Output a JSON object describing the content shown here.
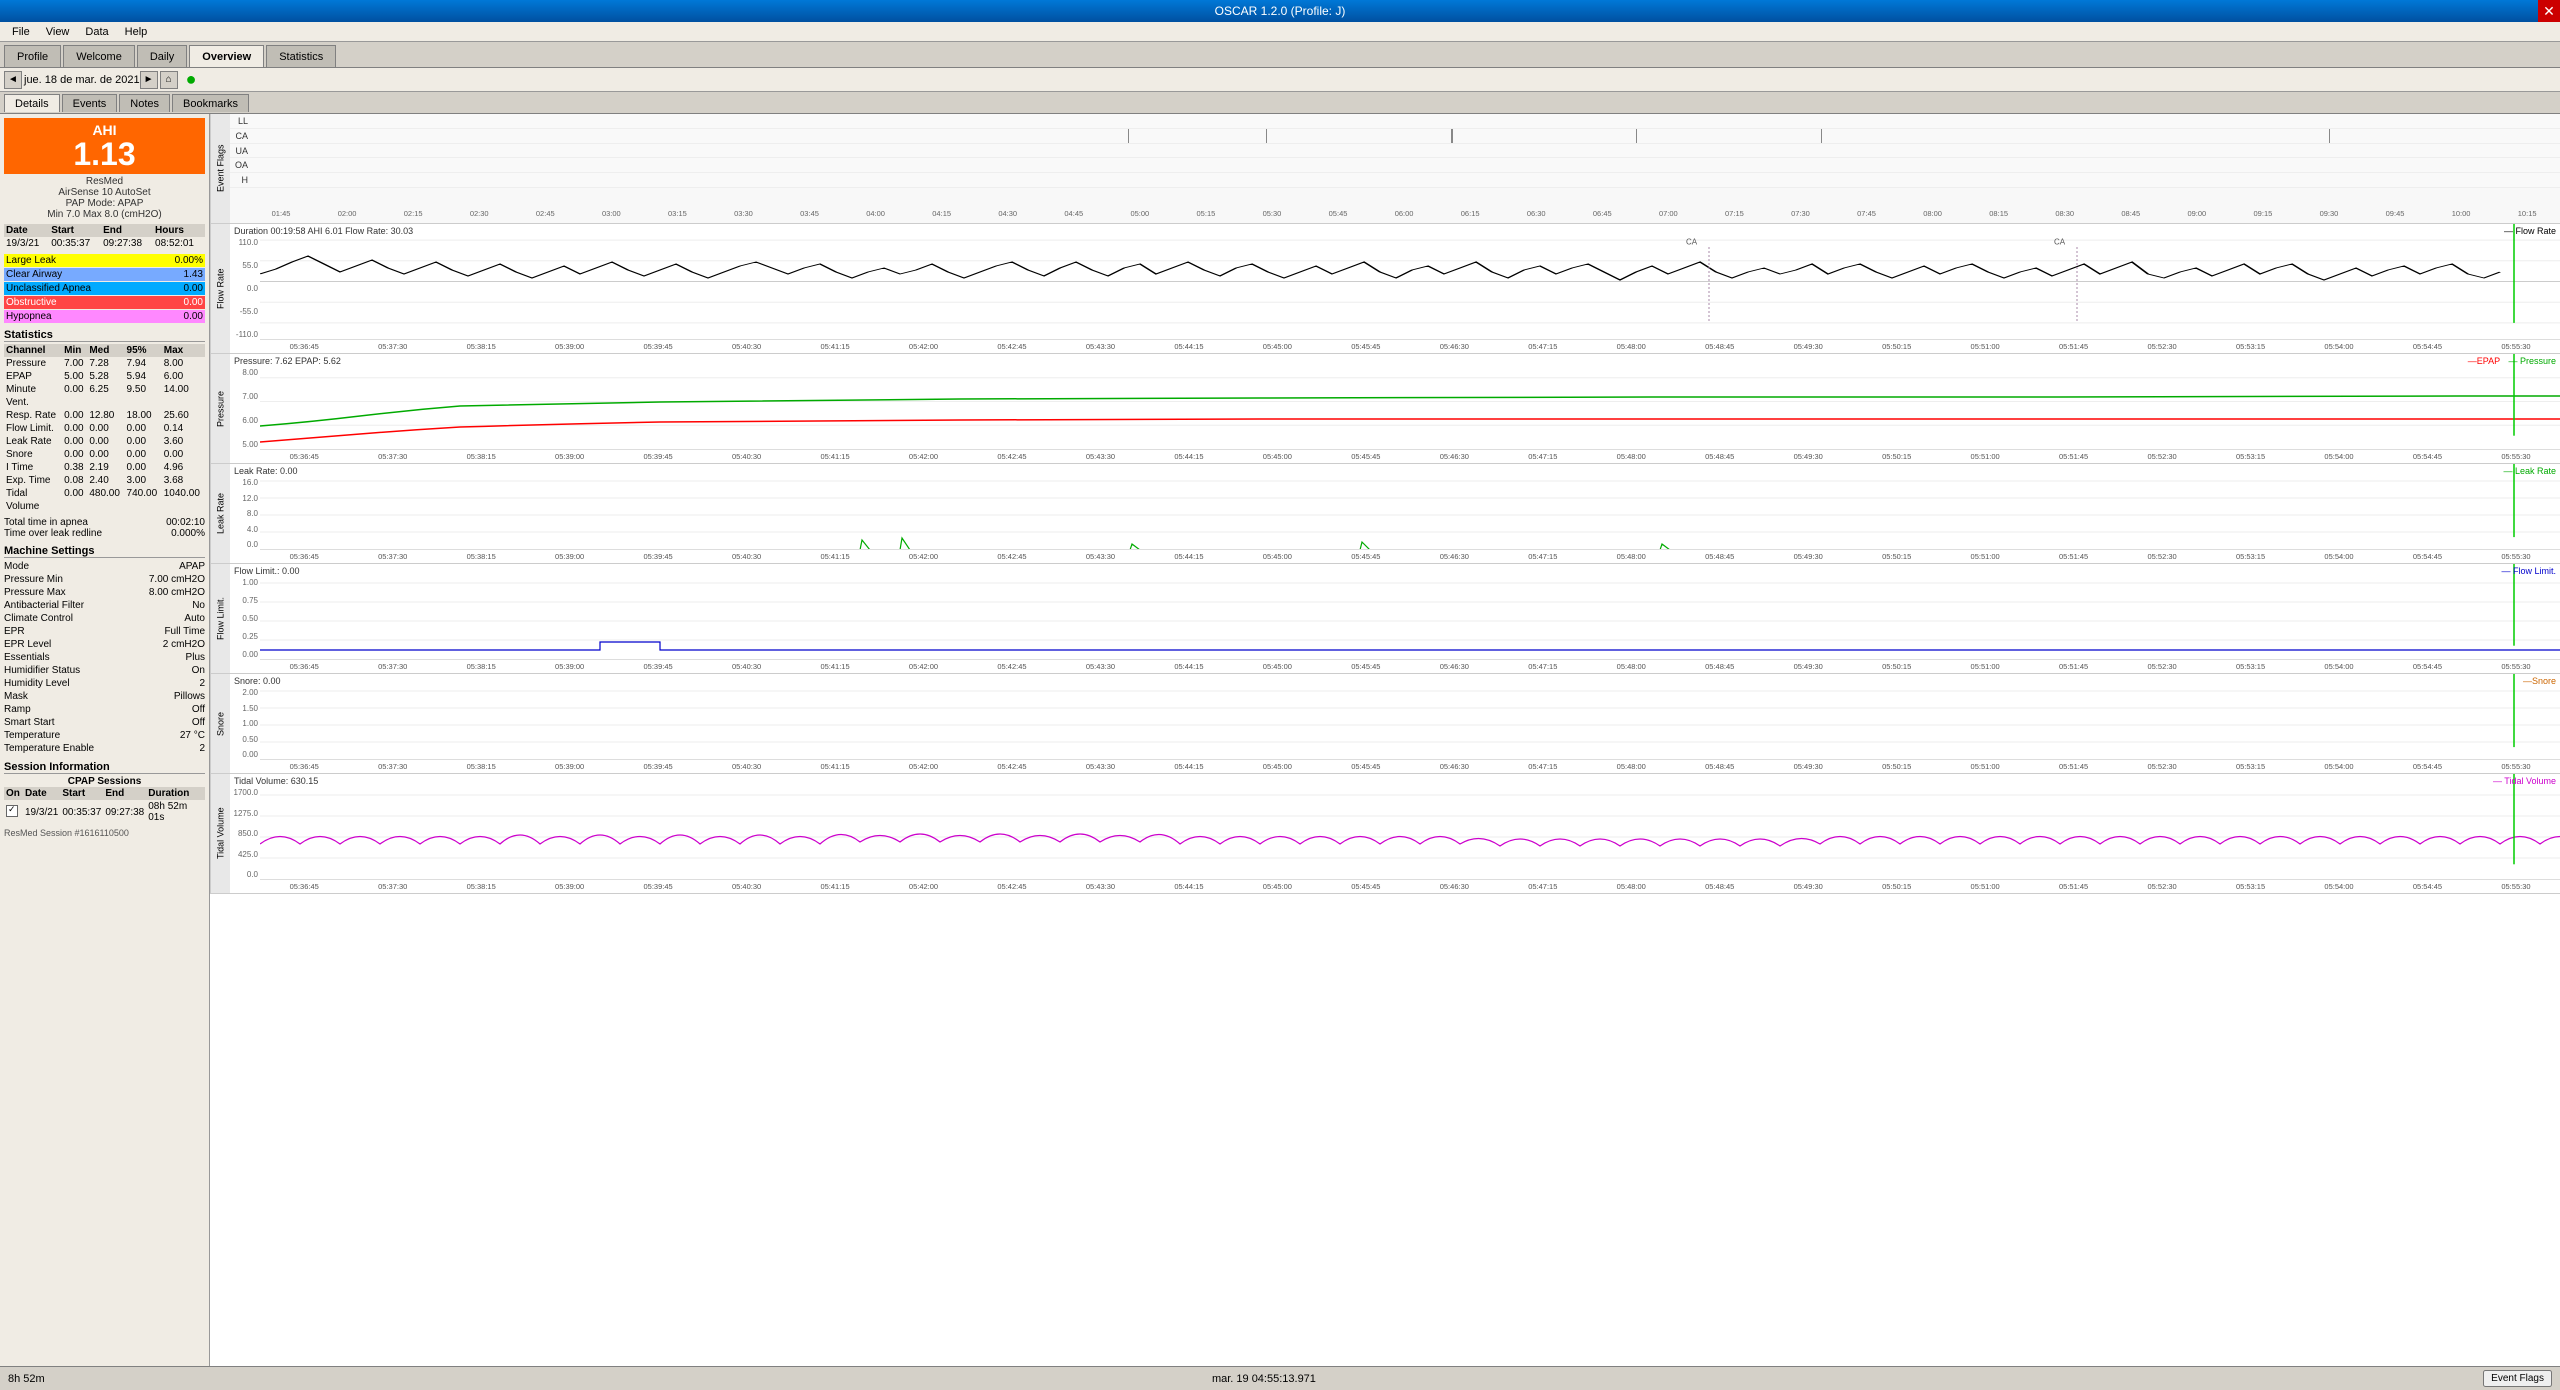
{
  "titlebar": {
    "title": "OSCAR 1.2.0 (Profile: J)"
  },
  "menubar": {
    "items": [
      "File",
      "View",
      "Data",
      "Help"
    ]
  },
  "tabs": {
    "main": [
      "Profile",
      "Welcome",
      "Daily",
      "Overview",
      "Statistics"
    ],
    "active_main": "Daily",
    "sub": [
      "Details",
      "Events",
      "Notes",
      "Bookmarks"
    ],
    "active_sub": "Details"
  },
  "navbar": {
    "date": "jue. 18 de mar. de 2021",
    "prev_label": "◄",
    "next_label": "►"
  },
  "sidebar": {
    "ahi": {
      "value": "1.13",
      "label": "AHI"
    },
    "device": "ResMed",
    "device_model": "AirSense 10 AutoSet",
    "pap_mode": "PAP Mode: APAP",
    "min_max": "Min 7.0 Max 8.0 (cmH2O)",
    "session": {
      "date": "19/3/21",
      "start": "00:35:37",
      "end": "09:27:38",
      "hours": "08:52:01"
    },
    "events": [
      {
        "label": "Large Leak",
        "value": "0.00%",
        "color": "#ffff00",
        "text_color": "#000"
      },
      {
        "label": "Clear Airway",
        "value": "1.43",
        "color": "#77aaff",
        "text_color": "#000"
      },
      {
        "label": "Unclassified Apnea",
        "value": "0.00",
        "color": "#00aaff",
        "text_color": "#000"
      },
      {
        "label": "Obstructive",
        "value": "0.00",
        "color": "#cc0000",
        "text_color": "#fff"
      },
      {
        "label": "Hypopnea",
        "value": "0.00",
        "color": "#ff88ff",
        "text_color": "#000"
      }
    ],
    "statistics": {
      "header": "Statistics",
      "columns": [
        "Channel",
        "Min",
        "Med",
        "95%",
        "Max"
      ],
      "rows": [
        [
          "Pressure",
          "7.00",
          "7.28",
          "7.94",
          "8.00"
        ],
        [
          "EPAP",
          "5.00",
          "5.28",
          "5.94",
          "6.00"
        ],
        [
          "Minute",
          "0.00",
          "6.25",
          "9.50",
          "14.00"
        ],
        [
          "Vent.",
          "",
          "",
          "",
          ""
        ],
        [
          "Resp. Rate",
          "0.00",
          "12.80",
          "18.00",
          "25.60"
        ],
        [
          "Flow Limit.",
          "0.00",
          "0.00",
          "0.00",
          "0.14"
        ],
        [
          "Leak Rate",
          "0.00",
          "0.00",
          "0.00",
          "3.60"
        ],
        [
          "Snore",
          "0.00",
          "0.00",
          "0.00",
          "0.00"
        ],
        [
          "I Time",
          "0.38",
          "2.19",
          "0.00",
          "4.96"
        ],
        [
          "Exp. Time",
          "0.08",
          "2.40",
          "3.00",
          "3.68"
        ],
        [
          "Tidal",
          "0.00",
          "480.00",
          "740.00",
          "1040.00"
        ],
        [
          "Volume",
          "",
          "",
          "",
          ""
        ]
      ]
    },
    "apnea_info": {
      "total_time": "Total time in apnea",
      "total_value": "00:02:10",
      "time_over": "Time over leak redline",
      "time_over_value": "0.000%"
    },
    "machine_settings": {
      "header": "Machine Settings",
      "rows": [
        [
          "Mode",
          "APAP"
        ],
        [
          "Pressure Min",
          "7.00 cmH2O"
        ],
        [
          "Pressure Max",
          "8.00 cmH2O"
        ],
        [
          "Antibacterial Filter",
          "No"
        ],
        [
          "Climate Control",
          "Auto"
        ],
        [
          "EPR",
          "Full Time"
        ],
        [
          "EPR Level",
          "2 cmH2O"
        ],
        [
          "Essentials",
          "Plus"
        ],
        [
          "Humidifier Status",
          "On"
        ],
        [
          "Humidity Level",
          "2"
        ],
        [
          "Mask",
          "Pillows"
        ],
        [
          "Ramp",
          "Off"
        ],
        [
          "Smart Start",
          "Off"
        ],
        [
          "Temperature",
          "27 °C"
        ],
        [
          "Temperature Enable",
          "2"
        ]
      ]
    },
    "session_info": {
      "header": "Session Information",
      "sub_header": "CPAP Sessions",
      "columns": [
        "On",
        "Date",
        "Start",
        "End",
        "Duration"
      ],
      "sessions": [
        {
          "checked": true,
          "date": "19/3/21",
          "start": "00:35:37",
          "end": "09:27:38",
          "duration": "08h 52m 01s",
          "session_id": "ResMed Session #1616110500"
        }
      ]
    }
  },
  "charts": {
    "event_flags": {
      "label": "Event Flags",
      "rows": [
        "LL",
        "CA",
        "UA",
        "OA",
        "H"
      ],
      "time_ticks": [
        "01:45",
        "02:00",
        "02:15",
        "02:30",
        "02:45",
        "03:00",
        "03:15",
        "03:30",
        "03:45",
        "04:00",
        "04:15",
        "04:30",
        "04:45",
        "05:00",
        "05:15",
        "05:30",
        "05:45",
        "06:00",
        "06:15",
        "06:30",
        "06:45",
        "07:00",
        "07:15",
        "07:30",
        "07:45",
        "08:00",
        "08:15",
        "08:30",
        "08:45",
        "09:00",
        "09:15",
        "09:30",
        "09:45",
        "10:00",
        "10:15"
      ]
    },
    "flow_rate": {
      "label": "Flow Rate",
      "header": "Duration 00:19:58 AHI 6.01 Flow Rate: 30.03",
      "legend": "— Flow Rate",
      "legend_color": "#000",
      "y_labels": [
        "110.0",
        "55.0",
        "0.0",
        "-55.0",
        "-110.0"
      ],
      "time_ticks": [
        "05:36:45",
        "05:37:30",
        "05:38:15",
        "05:39:00",
        "05:39:45",
        "05:40:30",
        "05:41:15",
        "05:42:00",
        "05:42:45",
        "05:43:30",
        "05:44:15",
        "05:45:00",
        "05:45:45",
        "05:46:30",
        "05:47:15",
        "05:48:00",
        "05:48:45",
        "05:49:30",
        "05:50:15",
        "05:51:00",
        "05:51:45",
        "05:52:30",
        "05:53:15",
        "05:54:00",
        "05:54:45",
        "05:55:30"
      ]
    },
    "pressure": {
      "label": "Pressure",
      "header": "Pressure: 7.62 EPAP: 5.62",
      "legend_epap": "—EPAP",
      "legend_epap_color": "#ff0000",
      "legend_pressure": "— Pressure",
      "legend_pressure_color": "#00aa00",
      "y_labels": [
        "8.00",
        "7.00",
        "6.00",
        "5.00"
      ],
      "time_ticks": [
        "05:36:45",
        "05:37:30",
        "05:38:15",
        "05:39:00",
        "05:39:45",
        "05:40:30",
        "05:41:15",
        "05:42:00",
        "05:42:45",
        "05:43:30",
        "05:44:15",
        "05:45:00",
        "05:45:45",
        "05:46:30",
        "05:47:15",
        "05:48:00",
        "05:48:45",
        "05:49:30",
        "05:50:15",
        "05:51:00",
        "05:51:45",
        "05:52:30",
        "05:53:15",
        "05:54:00",
        "05:54:45",
        "05:55:30"
      ]
    },
    "leak_rate": {
      "label": "Leak Rate",
      "header": "Leak Rate: 0.00",
      "legend": "— Leak Rate",
      "legend_color": "#00aa00",
      "y_labels": [
        "16.0",
        "12.0",
        "8.0",
        "4.0",
        "0.0"
      ],
      "time_ticks": [
        "05:36:45",
        "05:37:30",
        "05:38:15",
        "05:39:00",
        "05:39:45",
        "05:40:30",
        "05:41:15",
        "05:42:00",
        "05:42:45",
        "05:43:30",
        "05:44:15",
        "05:45:00",
        "05:45:45",
        "05:46:30",
        "05:47:15",
        "05:48:00",
        "05:48:45",
        "05:49:30",
        "05:50:15",
        "05:51:00",
        "05:51:45",
        "05:52:30",
        "05:53:15",
        "05:54:00",
        "05:54:45",
        "05:55:30"
      ]
    },
    "flow_limit": {
      "label": "Flow Limit.",
      "header": "Flow Limit.: 0.00",
      "legend": "— Flow Limit.",
      "legend_color": "#0000cc",
      "y_labels": [
        "1.00",
        "0.75",
        "0.50",
        "0.25",
        "0.00"
      ],
      "time_ticks": [
        "05:36:45",
        "05:37:30",
        "05:38:15",
        "05:39:00",
        "05:39:45",
        "05:40:30",
        "05:41:15",
        "05:42:00",
        "05:42:45",
        "05:43:30",
        "05:44:15",
        "05:45:00",
        "05:45:45",
        "05:46:30",
        "05:47:15",
        "05:48:00",
        "05:48:45",
        "05:49:30",
        "05:50:15",
        "05:51:00",
        "05:51:45",
        "05:52:30",
        "05:53:15",
        "05:54:00",
        "05:54:45",
        "05:55:30"
      ]
    },
    "snore": {
      "label": "Snore",
      "header": "Snore: 0.00",
      "legend": "—Snore",
      "legend_color": "#cc6600",
      "y_labels": [
        "2.00",
        "1.50",
        "1.00",
        "0.50",
        "0.00"
      ],
      "time_ticks": [
        "05:36:45",
        "05:37:30",
        "05:38:15",
        "05:39:00",
        "05:39:45",
        "05:40:30",
        "05:41:15",
        "05:42:00",
        "05:42:45",
        "05:43:30",
        "05:44:15",
        "05:45:00",
        "05:45:45",
        "05:46:30",
        "05:47:15",
        "05:48:00",
        "05:48:45",
        "05:49:30",
        "05:50:15",
        "05:51:00",
        "05:51:45",
        "05:52:30",
        "05:53:15",
        "05:54:00",
        "05:54:45",
        "05:55:30"
      ]
    },
    "tidal_volume": {
      "label": "Tidal Volume",
      "header": "Tidal Volume: 630.15",
      "legend": "— Tidal Volume",
      "legend_color": "#cc00cc",
      "y_labels": [
        "1700.0",
        "1275.0",
        "850.0",
        "425.0",
        "0.0"
      ],
      "time_ticks": [
        "05:36:45",
        "05:37:30",
        "05:38:15",
        "05:39:00",
        "05:39:45",
        "05:40:30",
        "05:41:15",
        "05:42:00",
        "05:42:45",
        "05:43:30",
        "05:44:15",
        "05:45:00",
        "05:45:45",
        "05:46:30",
        "05:47:15",
        "05:48:00",
        "05:48:45",
        "05:49:30",
        "05:50:15",
        "05:51:00",
        "05:51:45",
        "05:52:30",
        "05:53:15",
        "05:54:00",
        "05:54:45",
        "05:55:30"
      ]
    }
  },
  "statusbar": {
    "duration": "8h 52m",
    "datetime": "mar. 19 04:55:13.971",
    "event_flags_label": "Event Flags"
  }
}
